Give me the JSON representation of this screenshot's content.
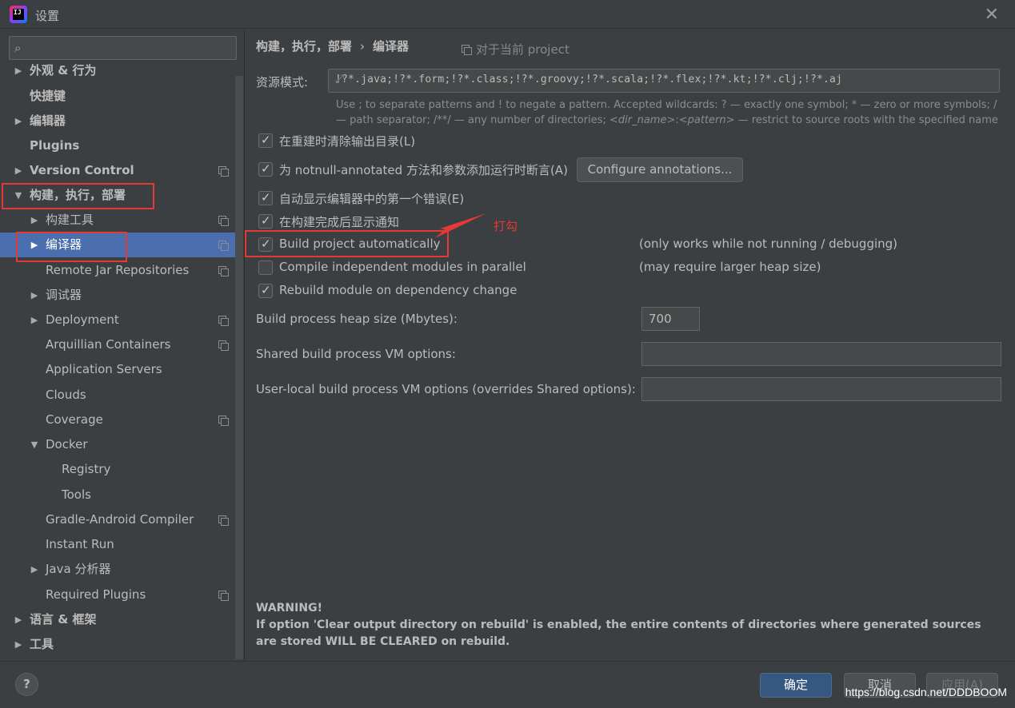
{
  "window": {
    "title": "设置",
    "icon_letters": "IJ"
  },
  "search": {
    "placeholder": ""
  },
  "sidebar": {
    "items": [
      {
        "label": "外观 & 行为"
      },
      {
        "label": "快捷键"
      },
      {
        "label": "编辑器"
      },
      {
        "label": "Plugins"
      },
      {
        "label": "Version Control"
      },
      {
        "label": "构建，执行，部署"
      },
      {
        "label": "构建工具"
      },
      {
        "label": "编译器"
      },
      {
        "label": "Remote Jar Repositories"
      },
      {
        "label": "调试器"
      },
      {
        "label": "Deployment"
      },
      {
        "label": "Arquillian Containers"
      },
      {
        "label": "Application Servers"
      },
      {
        "label": "Clouds"
      },
      {
        "label": "Coverage"
      },
      {
        "label": "Docker"
      },
      {
        "label": "Registry"
      },
      {
        "label": "Tools"
      },
      {
        "label": "Gradle-Android Compiler"
      },
      {
        "label": "Instant Run"
      },
      {
        "label": "Java 分析器"
      },
      {
        "label": "Required Plugins"
      },
      {
        "label": "语言 & 框架"
      },
      {
        "label": "工具"
      }
    ]
  },
  "main": {
    "breadcrumb": {
      "parent": "构建，执行，部署",
      "separator": "›",
      "current": "编译器"
    },
    "for_project": "对于当前 project",
    "resource_patterns": {
      "label": "资源模式:",
      "value": "!?*.java;!?*.form;!?*.class;!?*.groovy;!?*.scala;!?*.flex;!?*.kt;!?*.clj;!?*.aj",
      "hint_part1": "Use ; to separate patterns and ! to negate a pattern. Accepted wildcards: ? — exactly one symbol; * — zero or more symbols; / — path separator; /**/ — any number of directories; ",
      "hint_dirname": "<dir_name>",
      "hint_colon": ":",
      "hint_pattern": "<pattern>",
      "hint_part2": " — restrict to source roots with the specified name"
    },
    "options": [
      {
        "label": "在重建时清除输出目录(L)",
        "checked": true
      },
      {
        "label": "为 notnull-annotated 方法和参数添加运行时断言(A)",
        "checked": true
      },
      {
        "label": "自动显示编辑器中的第一个错误(E)",
        "checked": true
      },
      {
        "label": "在构建完成后显示通知",
        "checked": true
      },
      {
        "label": "Build project automatically",
        "checked": true,
        "note": "(only works while not running / debugging)"
      },
      {
        "label": "Compile independent modules in parallel",
        "checked": false,
        "note": "(may require larger heap size)"
      },
      {
        "label": "Rebuild module on dependency change",
        "checked": true
      }
    ],
    "configure_annotations": "Configure annotations...",
    "heap_size": {
      "label": "Build process heap size (Mbytes):",
      "value": "700"
    },
    "shared_vm": {
      "label": "Shared build process VM options:",
      "value": ""
    },
    "user_vm": {
      "label": "User-local build process VM options (overrides Shared options):",
      "value": ""
    },
    "warning": {
      "title": "WARNING!",
      "body": "If option 'Clear output directory on rebuild' is enabled, the entire contents of directories where generated sources are stored WILL BE CLEARED on rebuild."
    },
    "annotation_text": "打勾"
  },
  "footer": {
    "help": "?",
    "ok": "确定",
    "cancel": "取消",
    "apply": "应用(A)",
    "watermark": "https://blog.csdn.net/DDDBOOM"
  },
  "colors": {
    "selection": "#4b6eaf",
    "highlight": "#e53935",
    "background": "#3c3f41"
  }
}
